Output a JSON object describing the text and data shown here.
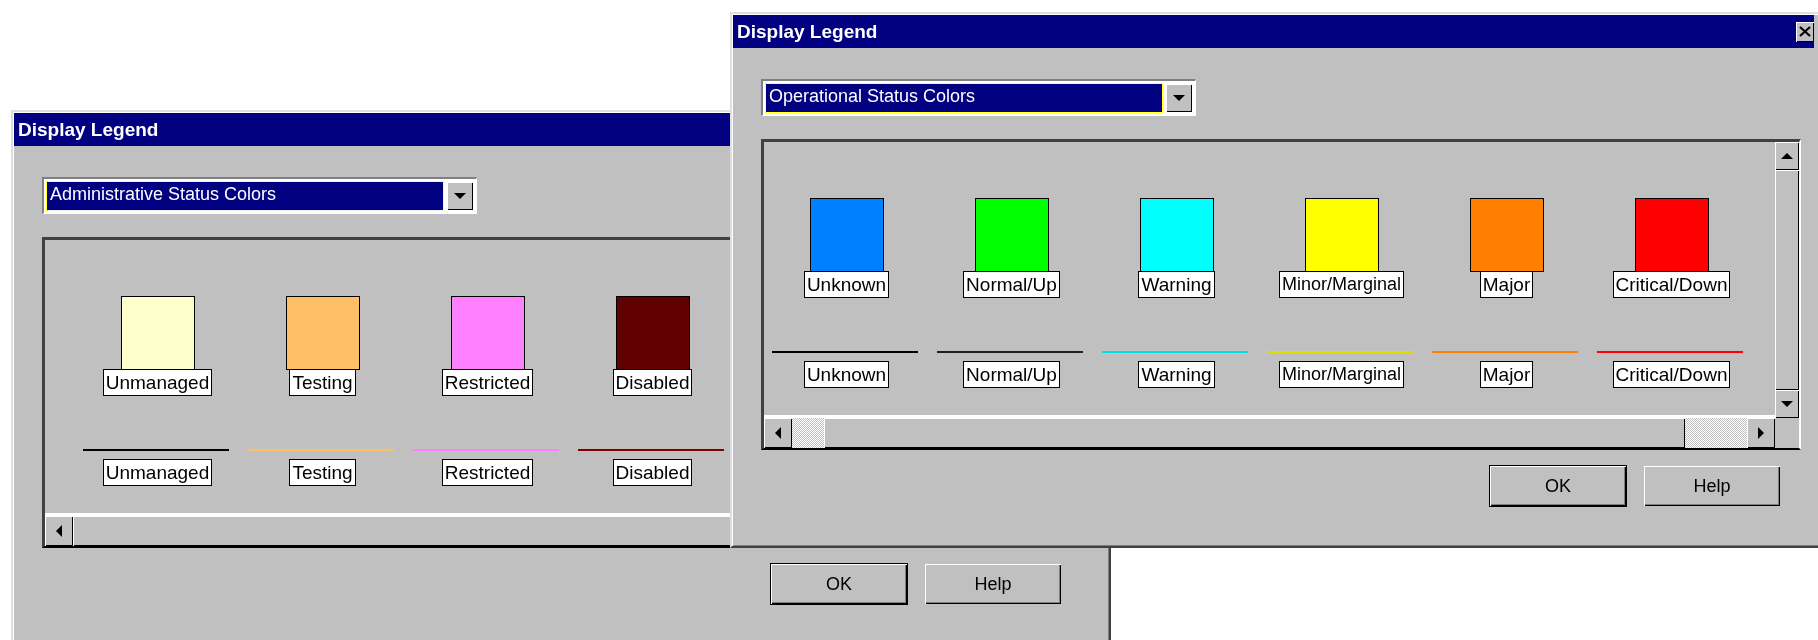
{
  "windows": [
    {
      "title": "Display Legend",
      "dropdown": {
        "value": "Administrative Status Colors"
      },
      "swatches": [
        {
          "label": "Unmanaged",
          "color": "#ffffcc"
        },
        {
          "label": "Testing",
          "color": "#ffbf66"
        },
        {
          "label": "Restricted",
          "color": "#ff80ff"
        },
        {
          "label": "Disabled",
          "color": "#600000"
        }
      ],
      "lines": [
        {
          "label": "Unmanaged",
          "color": "#000000"
        },
        {
          "label": "Testing",
          "color": "#ffbf66"
        },
        {
          "label": "Restricted",
          "color": "#ff80ff"
        },
        {
          "label": "Disabled",
          "color": "#800000"
        }
      ],
      "buttons": [
        {
          "label": "OK",
          "default": true
        },
        {
          "label": "Help",
          "default": false
        }
      ]
    },
    {
      "title": "Display Legend",
      "close": true,
      "vertical_scrollbar": true,
      "dropdown": {
        "value": "Operational Status Colors"
      },
      "swatches": [
        {
          "label": "Unknown",
          "color": "#0080ff"
        },
        {
          "label": "Normal/Up",
          "color": "#00ff00"
        },
        {
          "label": "Warning",
          "color": "#00ffff"
        },
        {
          "label": "Minor/Marginal",
          "color": "#ffff00"
        },
        {
          "label": "Major",
          "color": "#ff8000"
        },
        {
          "label": "Critical/Down",
          "color": "#ff0000"
        }
      ],
      "lines": [
        {
          "label": "Unknown",
          "color": "#000000"
        },
        {
          "label": "Normal/Up",
          "color": "#202020"
        },
        {
          "label": "Warning",
          "color": "#00e0e0"
        },
        {
          "label": "Minor/Marginal",
          "color": "#e0e000"
        },
        {
          "label": "Major",
          "color": "#ff8000"
        },
        {
          "label": "Critical/Down",
          "color": "#ff0000"
        }
      ],
      "buttons": [
        {
          "label": "OK",
          "default": true
        },
        {
          "label": "Help",
          "default": false
        }
      ]
    }
  ]
}
